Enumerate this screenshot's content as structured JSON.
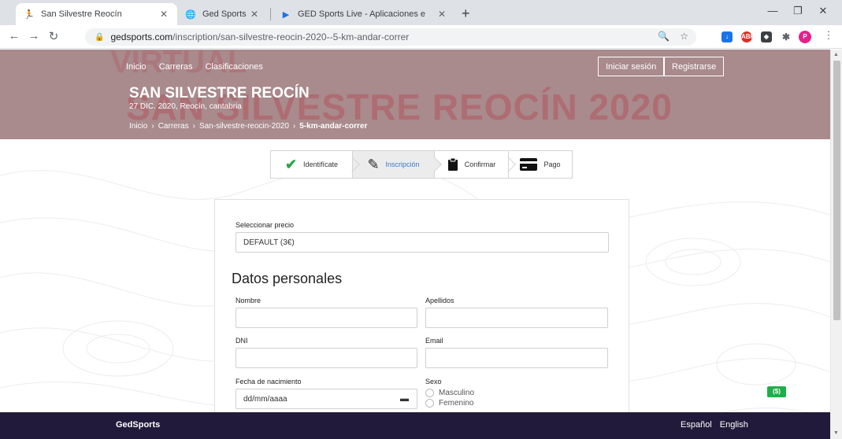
{
  "browser": {
    "tabs": [
      {
        "title": "San Silvestre Reocín",
        "icon": "running-icon"
      },
      {
        "title": "Ged Sports",
        "icon": "globe-icon"
      },
      {
        "title": "GED Sports Live - Aplicaciones e",
        "icon": "play-store-icon"
      }
    ],
    "url_host": "gedsports.com",
    "url_path": "/inscription/san-silvestre-reocin-2020--5-km-andar-correr"
  },
  "site": {
    "nav": [
      "Inicio",
      "Carreras",
      "Clasificaciones"
    ],
    "login": "Iniciar sesión",
    "register": "Registrarse",
    "watermark": "SAN SILVESTRE REOCÍN 2020",
    "watermark_top": "VIRTUAL"
  },
  "event": {
    "title": "SAN SILVESTRE REOCÍN",
    "subtitle": "27 DIC. 2020, Reocín, cantabria",
    "breadcrumb": [
      "Inicio",
      "Carreras",
      "San-silvestre-reocin-2020",
      "5-km-andar-correr"
    ]
  },
  "steps": [
    {
      "label": "Identifícate",
      "icon": "check-icon",
      "active": false,
      "color": "#2aa84a"
    },
    {
      "label": "Inscripción",
      "icon": "edit-icon",
      "active": true
    },
    {
      "label": "Confirmar",
      "icon": "clipboard-icon",
      "active": false
    },
    {
      "label": "Pago",
      "icon": "credit-card-icon",
      "active": false
    }
  ],
  "form": {
    "price_label": "Seleccionar precio",
    "price_value": "DEFAULT (3€)",
    "section_title": "Datos personales",
    "fields": {
      "nombre": "Nombre",
      "apellidos": "Apellidos",
      "dni": "DNI",
      "email": "Email",
      "fecha": "Fecha de nacimiento",
      "fecha_placeholder": "dd/mm/aaaa",
      "sexo": "Sexo"
    },
    "sexo_options": [
      "Masculino",
      "Femenino"
    ]
  },
  "footer": {
    "brand": "GedSports",
    "languages": [
      "Español",
      "English"
    ]
  },
  "colors": {
    "hero": "#a98a8d",
    "watermark": "#b2565e",
    "footer": "#221a3a",
    "active_step_text": "#3a78c8"
  }
}
